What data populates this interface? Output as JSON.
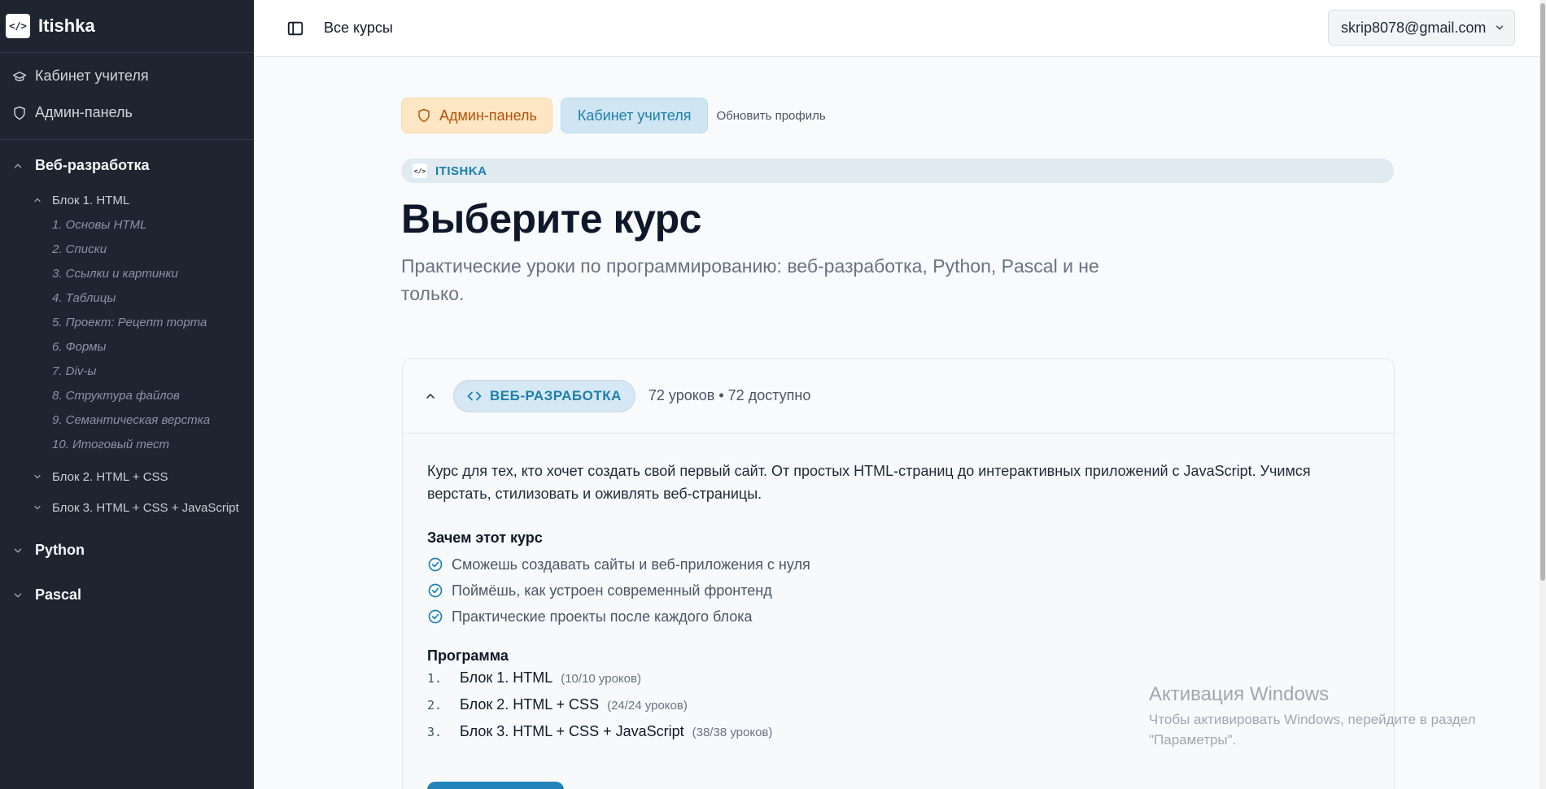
{
  "brand": {
    "logo_glyph": "</>",
    "name": "Itishka"
  },
  "sidebar": {
    "top_links": [
      {
        "label": "Кабинет учителя",
        "icon": "graduation-cap-icon"
      },
      {
        "label": "Админ-панель",
        "icon": "shield-icon"
      }
    ],
    "sections": [
      {
        "label": "Веб-разработка",
        "expanded": true,
        "blocks": [
          {
            "label": "Блок 1. HTML",
            "expanded": true,
            "lessons": [
              "1. Основы HTML",
              "2. Списки",
              "3. Ссылки и картинки",
              "4. Таблицы",
              "5. Проект: Рецепт торта",
              "6. Формы",
              "7. Div-ы",
              "8. Структура файлов",
              "9. Семантическая верстка",
              "10. Итоговый тест"
            ]
          },
          {
            "label": "Блок 2. HTML + CSS",
            "expanded": false
          },
          {
            "label": "Блок 3. HTML + CSS + JavaScript",
            "expanded": false
          }
        ]
      },
      {
        "label": "Python",
        "expanded": false
      },
      {
        "label": "Pascal",
        "expanded": false
      }
    ]
  },
  "topbar": {
    "breadcrumb": "Все курсы",
    "user_email": "skrip8078@gmail.com"
  },
  "hero": {
    "admin_button": "Админ-панель",
    "teacher_button": "Кабинет учителя",
    "update_profile": "Обновить профиль",
    "pill_logo": "</>",
    "pill_label": "ITISHKA",
    "title": "Выберите курс",
    "subtitle": "Практические уроки по программированию: веб-разработка, Python, Pascal и не только."
  },
  "course": {
    "badge": "ВЕБ-РАЗРАБОТКА",
    "meta": "72 уроков • 72 доступно",
    "description": "Курс для тех, кто хочет создать свой первый сайт. От простых HTML-страниц до интерактивных приложений с JavaScript. Учимся верстать, стилизовать и оживлять веб-страницы.",
    "why_title": "Зачем этот курс",
    "benefits": [
      "Сможешь создавать сайты и веб-приложения с нуля",
      "Поймёшь, как устроен современный фронтенд",
      "Практические проекты после каждого блока"
    ],
    "program_title": "Программа",
    "program": [
      {
        "num": "1.",
        "name": "Блок 1. HTML",
        "count": "(10/10 уроков)"
      },
      {
        "num": "2.",
        "name": "Блок 2. HTML + CSS",
        "count": "(24/24 уроков)"
      },
      {
        "num": "3.",
        "name": "Блок 3. HTML + CSS + JavaScript",
        "count": "(38/38 уроков)"
      }
    ]
  },
  "watermark": {
    "title": "Активация Windows",
    "text": "Чтобы активировать Windows, перейдите в раздел \"Параметры\"."
  },
  "colors": {
    "sidebar_bg": "#1e2430",
    "accent": "#1f7fae",
    "admin_accent": "#b45309"
  }
}
